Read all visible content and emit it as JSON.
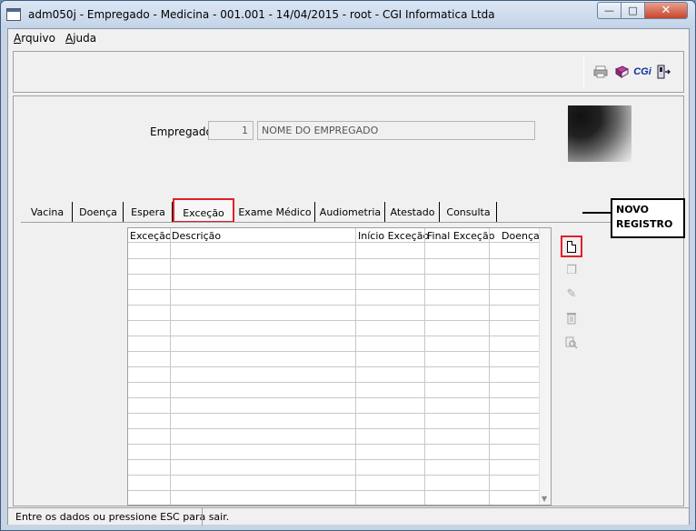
{
  "window": {
    "title": "adm050j - Empregado - Medicina - 001.001 - 14/04/2015 - root - CGI Informatica Ltda",
    "minimize_icon": "minimize-icon",
    "maximize_icon": "maximize-icon",
    "close_icon": "close-icon"
  },
  "menu": {
    "items": [
      {
        "label": "Arquivo",
        "accel": "A",
        "rest": "rquivo"
      },
      {
        "label": "Ajuda",
        "accel": "A",
        "rest": "juda"
      }
    ]
  },
  "toolbar": {
    "icons": [
      "printer-icon",
      "book-icon",
      "cgi-logo",
      "exit-door-icon"
    ],
    "cgi_text": "CGi"
  },
  "employee": {
    "label": "Empregado:",
    "code": "1",
    "name": "NOME DO EMPREGADO"
  },
  "tabs": [
    {
      "label": "Vacina",
      "active": false
    },
    {
      "label": "Doença",
      "active": false
    },
    {
      "label": "Espera",
      "active": false
    },
    {
      "label": "Exceção",
      "active": true
    },
    {
      "label": "Exame Médico",
      "active": false
    },
    {
      "label": "Audiometria",
      "active": false
    },
    {
      "label": "Atestado",
      "active": false
    },
    {
      "label": "Consulta",
      "active": false
    }
  ],
  "grid": {
    "columns": [
      "Exceção",
      "Descrição",
      "Início Exceção",
      "Final Exceção",
      "Doença"
    ],
    "rows": []
  },
  "side_actions": [
    {
      "icon": "new-document-icon",
      "enabled": true
    },
    {
      "icon": "copy-icon",
      "enabled": false
    },
    {
      "icon": "edit-icon",
      "enabled": false
    },
    {
      "icon": "trash-icon",
      "enabled": false
    },
    {
      "icon": "search-document-icon",
      "enabled": false
    }
  ],
  "callout": {
    "line1": "NOVO",
    "line2": "REGISTRO"
  },
  "status": {
    "text": "Entre os dados ou pressione ESC para sair."
  },
  "colors": {
    "highlight": "#e0202a",
    "title_bar": "#c3d3e7",
    "cgi_logo": "#1030a0"
  }
}
